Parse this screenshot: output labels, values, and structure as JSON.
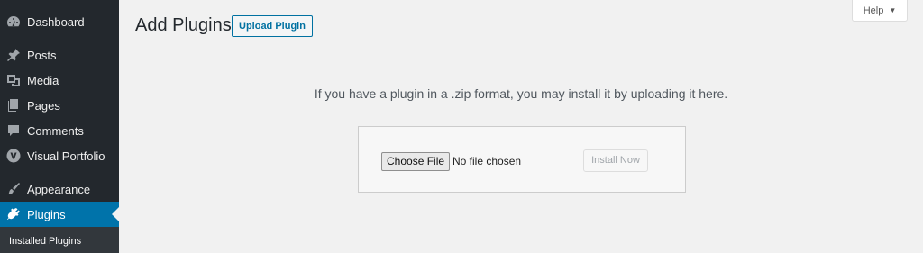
{
  "sidebar": {
    "items": [
      {
        "label": "Dashboard",
        "icon": "dashboard-icon"
      },
      {
        "label": "Posts",
        "icon": "pin-icon"
      },
      {
        "label": "Media",
        "icon": "media-icon"
      },
      {
        "label": "Pages",
        "icon": "pages-icon"
      },
      {
        "label": "Comments",
        "icon": "comment-icon"
      },
      {
        "label": "Visual Portfolio",
        "icon": "v-logo-icon"
      },
      {
        "label": "Appearance",
        "icon": "brush-icon"
      },
      {
        "label": "Plugins",
        "icon": "plug-icon",
        "active": true
      }
    ],
    "submenu": {
      "label": "Installed Plugins"
    }
  },
  "header": {
    "title": "Add Plugins",
    "upload_label": "Upload Plugin",
    "help_label": "Help"
  },
  "upload": {
    "instructions": "If you have a plugin in a .zip format, you may install it by uploading it here.",
    "choose_label": "Choose File",
    "file_status": "No file chosen",
    "install_label": "Install Now"
  },
  "colors": {
    "sidebar_bg": "#23282d",
    "accent": "#0073aa",
    "page_bg": "#f1f1f1"
  }
}
